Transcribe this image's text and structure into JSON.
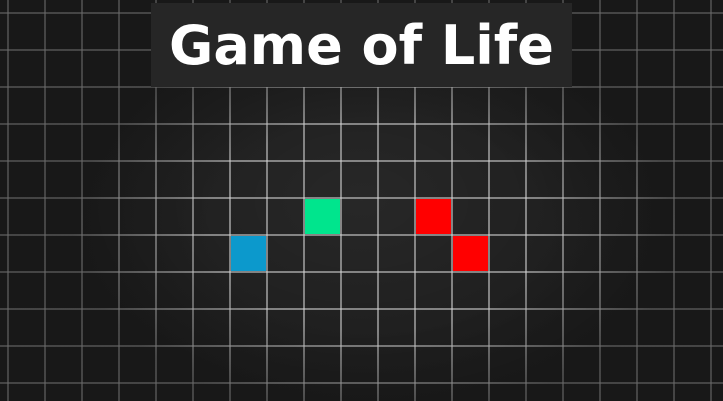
{
  "game": {
    "title": "Game of Life",
    "live_cells": [
      {
        "col": 6,
        "row": 6,
        "color": "#0c99cc"
      },
      {
        "col": 8,
        "row": 5,
        "color": "#00e58d"
      },
      {
        "col": 11,
        "row": 5,
        "color": "#ff0000"
      },
      {
        "col": 12,
        "row": 6,
        "color": "#ff0000"
      }
    ]
  },
  "colors": {
    "background": "#1c1c1c",
    "grid_line": "#d2d2d2",
    "title_box": "#262626",
    "title_text": "#ffffff"
  }
}
